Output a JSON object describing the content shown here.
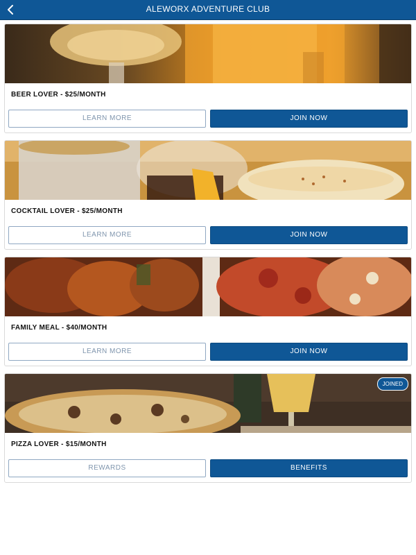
{
  "header": {
    "title": "ALEWORX ADVENTURE CLUB",
    "back_icon": "chevron-left-icon"
  },
  "colors": {
    "brand": "#0f5796",
    "outline_border": "#8fa7c2",
    "outline_text": "#7f95ad",
    "card_border": "#d9d9d9"
  },
  "cards": [
    {
      "title": "BEER LOVER - $25/MONTH",
      "image": "beer-glasses-photo",
      "secondary_label": "LEARN MORE",
      "primary_label": "JOIN NOW"
    },
    {
      "title": "COCKTAIL LOVER - $25/MONTH",
      "image": "cocktails-photo",
      "secondary_label": "LEARN MORE",
      "primary_label": "JOIN NOW"
    },
    {
      "title": "FAMILY MEAL - $40/MONTH",
      "image": "wings-and-pizza-photo",
      "secondary_label": "LEARN MORE",
      "primary_label": "JOIN NOW"
    },
    {
      "title": "PIZZA LOVER - $15/MONTH",
      "image": "pizza-and-beer-photo",
      "badge": "JOINED",
      "secondary_label": "REWARDS",
      "primary_label": "BENEFITS"
    }
  ]
}
